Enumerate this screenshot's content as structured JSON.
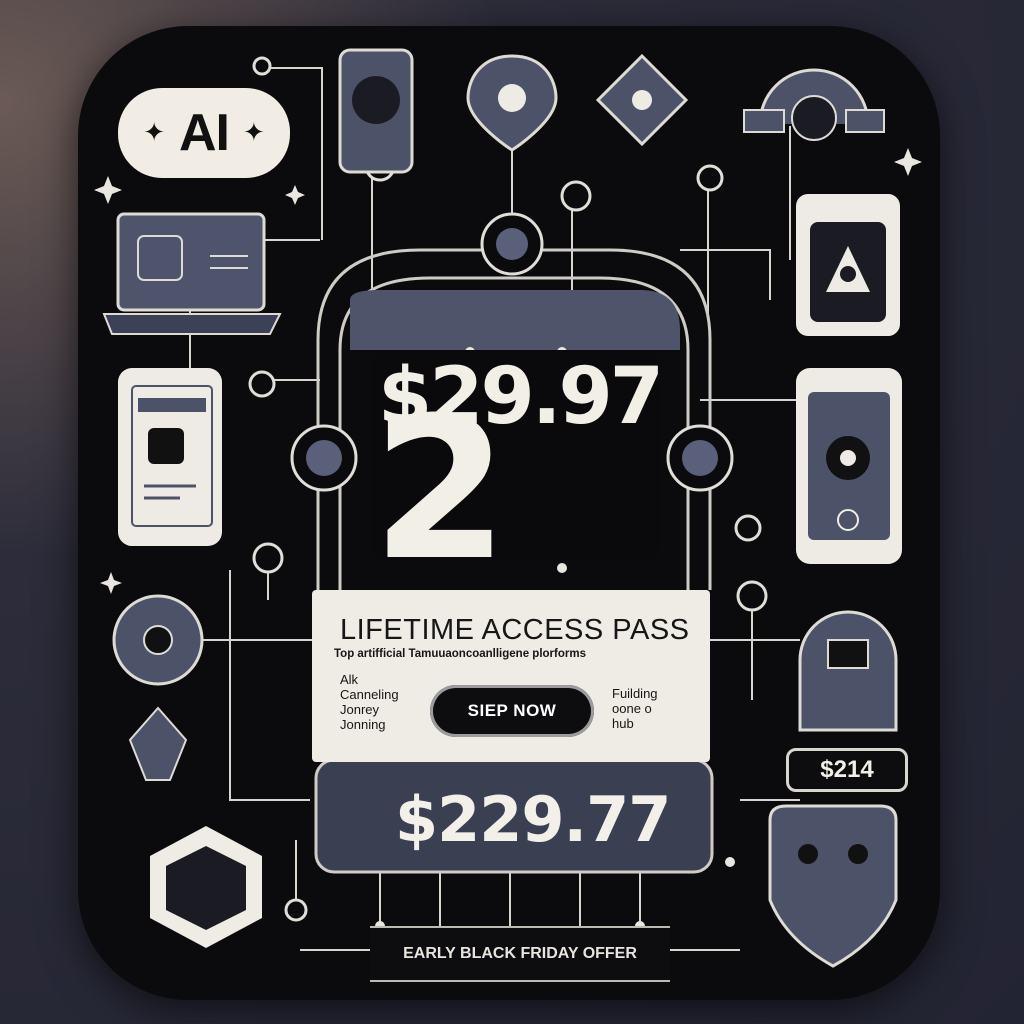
{
  "badge": {
    "text": "AI",
    "sparkle": "✦"
  },
  "price_main": {
    "currency": "$",
    "line1": "$29.97",
    "big_digit": "2"
  },
  "offer_panel": {
    "title": "LIFETIME ACCESS PASS",
    "subtitle": "Top artifficial Tamuuaoncoanlligene plorforms",
    "left_items": [
      "Alk",
      "Canneling",
      "Jonrey",
      "Jonning"
    ],
    "right_items": [
      "Fuilding",
      "oone o",
      "hub"
    ],
    "cta_label": "SIEP NOW"
  },
  "price_secondary": "$229.77",
  "price_small": "$214",
  "ribbon_label": "EARLY BLACK FRIDAY OFFER",
  "icons": [
    "laptop-icon",
    "phone-icon",
    "tablet-icon",
    "map-pin-icon",
    "diamond-eye-icon",
    "compass-icon",
    "target-icon",
    "hexagon-icon",
    "shield-face-icon",
    "robot-icon",
    "sparkle-icon"
  ],
  "colors": {
    "card": "#0b0b0e",
    "light": "#efece6",
    "slate": "#4a5068"
  }
}
